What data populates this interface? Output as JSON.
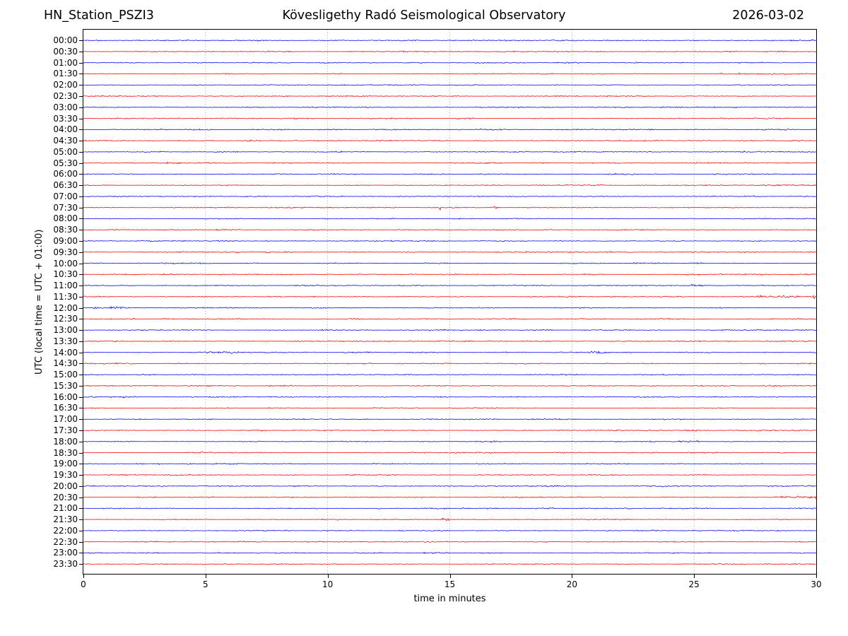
{
  "chart_data": {
    "type": "line",
    "subtype": "helicorder-dayplot",
    "title_left": "HN_Station_PSZI3",
    "title_center": "Kövesligethy Radó Seismological Observatory",
    "title_right": "2026-03-02",
    "xlabel": "time in minutes",
    "ylabel": "UTC (local time = UTC + 01:00)",
    "xlim": [
      0,
      30
    ],
    "xticks": [
      0,
      5,
      10,
      15,
      20,
      25,
      30
    ],
    "grid": {
      "vertical_dashed_at": [
        5,
        10,
        15,
        20,
        25
      ],
      "color": "#999999"
    },
    "trace_colors": {
      "hour": "#0000f5",
      "half_hour": "#f50000"
    },
    "frame_color": "#000000",
    "rows": [
      "00:00",
      "00:30",
      "01:00",
      "01:30",
      "02:00",
      "02:30",
      "03:00",
      "03:30",
      "04:00",
      "04:30",
      "05:00",
      "05:30",
      "06:00",
      "06:30",
      "07:00",
      "07:30",
      "08:00",
      "08:30",
      "09:00",
      "09:30",
      "10:00",
      "10:30",
      "11:00",
      "11:30",
      "12:00",
      "12:30",
      "13:00",
      "13:30",
      "14:00",
      "14:30",
      "15:00",
      "15:30",
      "16:00",
      "16:30",
      "17:00",
      "17:30",
      "18:00",
      "18:30",
      "19:00",
      "19:30",
      "20:00",
      "20:30",
      "21:00",
      "21:30",
      "22:00",
      "22:30",
      "23:00",
      "23:30"
    ],
    "events": [
      {
        "row": "05:30",
        "type": "burst",
        "x0": 3.3,
        "x1": 3.9,
        "amp": 1.6
      },
      {
        "row": "06:00",
        "type": "burst",
        "x0": 21.4,
        "x1": 22.6,
        "amp": 1.5
      },
      {
        "row": "07:30",
        "type": "spike",
        "x": 14.6,
        "amp": 4.5
      },
      {
        "row": "07:30",
        "type": "spike",
        "x": 16.9,
        "amp": 4.5
      },
      {
        "row": "11:00",
        "type": "burst",
        "x0": 24.9,
        "x1": 25.5,
        "amp": 1.8
      },
      {
        "row": "11:30",
        "type": "burst",
        "x0": 27.4,
        "x1": 29.3,
        "amp": 1.8
      },
      {
        "row": "11:30",
        "type": "spike",
        "x": 29.9,
        "amp": 3.0
      },
      {
        "row": "12:00",
        "type": "spike",
        "x": 0.55,
        "amp": 2.6
      },
      {
        "row": "12:00",
        "type": "spike",
        "x": 1.25,
        "amp": 2.6
      },
      {
        "row": "12:00",
        "type": "burst",
        "x0": 0.3,
        "x1": 1.6,
        "amp": 1.4
      },
      {
        "row": "14:00",
        "type": "burst",
        "x0": 5.0,
        "x1": 6.4,
        "amp": 1.5
      },
      {
        "row": "14:00",
        "type": "burst",
        "x0": 20.8,
        "x1": 21.6,
        "amp": 2.0
      },
      {
        "row": "16:00",
        "type": "burst",
        "x0": 0.0,
        "x1": 0.6,
        "amp": 2.0
      },
      {
        "row": "16:00",
        "type": "spike",
        "x": 1.65,
        "amp": 3.5
      },
      {
        "row": "17:30",
        "type": "burst",
        "x0": 24.7,
        "x1": 25.1,
        "amp": 1.5
      },
      {
        "row": "18:00",
        "type": "burst",
        "x0": 24.3,
        "x1": 25.2,
        "amp": 1.7
      },
      {
        "row": "20:30",
        "type": "burst",
        "x0": 28.2,
        "x1": 30.0,
        "amp": 2.2
      },
      {
        "row": "21:30",
        "type": "burst",
        "x0": 14.4,
        "x1": 15.2,
        "amp": 2.4
      }
    ],
    "legend_position": "none"
  }
}
